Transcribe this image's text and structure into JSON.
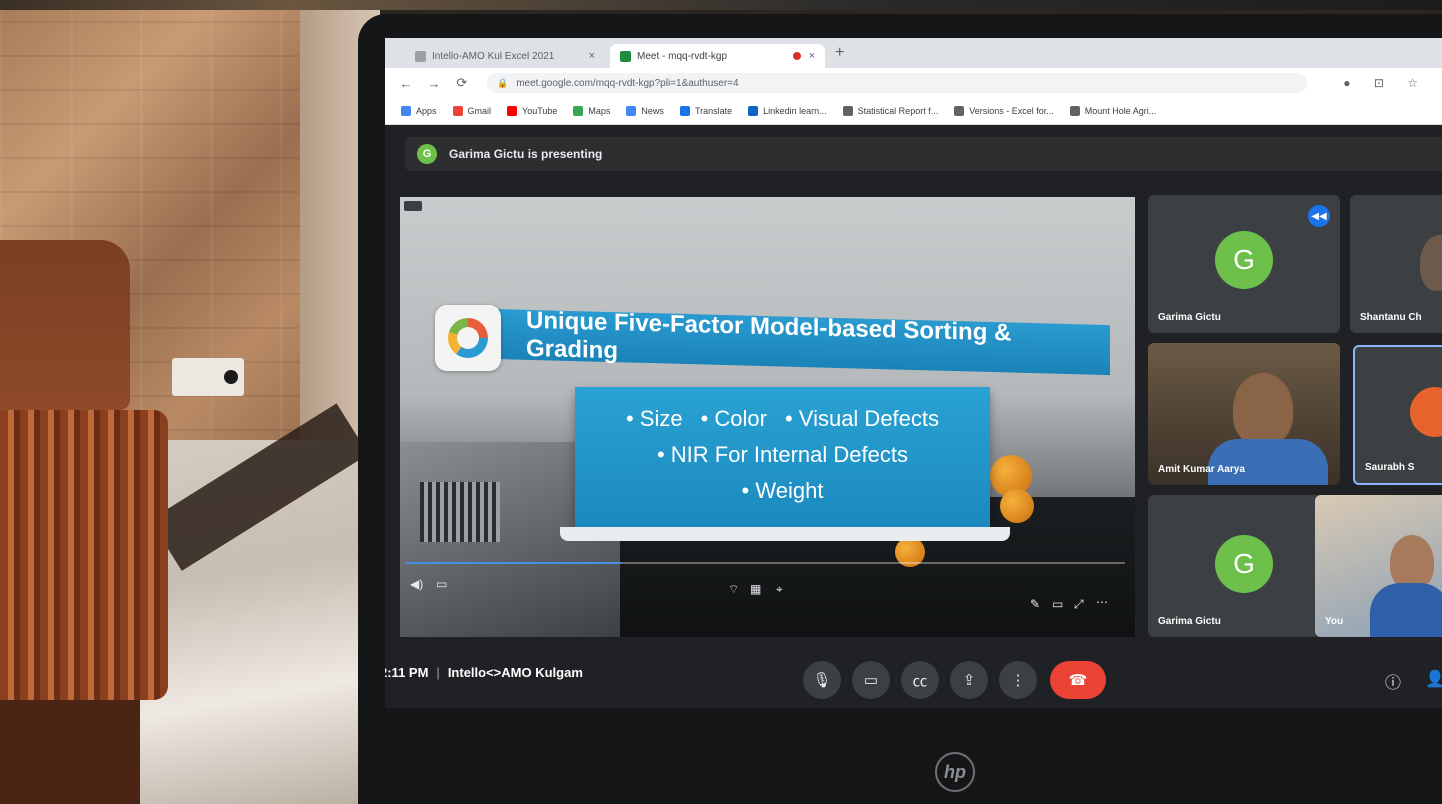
{
  "browser": {
    "tabs": [
      {
        "title": "Intello-AMO Kul Excel 2021"
      },
      {
        "title": "Meet - mqq-rvdt-kgp"
      }
    ],
    "tab_close": "×",
    "new_tab": "+",
    "url": "meet.google.com/mqq-rvdt-kgp?pli=1&authuser=4",
    "bookmarks": [
      {
        "label": "Apps",
        "color": "#4285f4"
      },
      {
        "label": "Gmail",
        "color": "#ea4335"
      },
      {
        "label": "YouTube",
        "color": "#ff0000"
      },
      {
        "label": "Maps",
        "color": "#34a853"
      },
      {
        "label": "News",
        "color": "#4285f4"
      },
      {
        "label": "Translate",
        "color": "#1a73e8"
      },
      {
        "label": "Linkedin learn...",
        "color": "#0a66c2"
      },
      {
        "label": "Statistical Report f...",
        "color": "#5f6368"
      },
      {
        "label": "Versions - Excel for...",
        "color": "#5f6368"
      },
      {
        "label": "Mount Hole Agri...",
        "color": "#5f6368"
      }
    ]
  },
  "meet": {
    "presenting_text": "Garima Gictu is presenting",
    "presenter_initial": "G",
    "slide": {
      "title": "Unique Five-Factor Model-based Sorting & Grading",
      "bullets_row1": [
        "• Size",
        "• Color",
        "• Visual Defects"
      ],
      "bullet_2": "• NIR For Internal Defects",
      "bullet_3": "• Weight"
    },
    "video_progress": 0.3,
    "participants": [
      {
        "name": "Garima Gictu",
        "initial": "G"
      },
      {
        "name": "Shantanu Ch"
      },
      {
        "name": "Amit Kumar Aarya"
      },
      {
        "name": "Saurabh S"
      },
      {
        "name": "Garima Gictu",
        "initial": "G"
      },
      {
        "name": "You"
      }
    ],
    "bottom": {
      "time": "2:11 PM",
      "separator": "|",
      "meeting_name": "Intello<>AMO Kulgam"
    }
  },
  "device": {
    "brand": "hp"
  },
  "colors": {
    "meet_bg": "#202124",
    "slide_blue": "#1b89bd",
    "avatar_green": "#6cc04a",
    "end_call": "#ea4335"
  }
}
